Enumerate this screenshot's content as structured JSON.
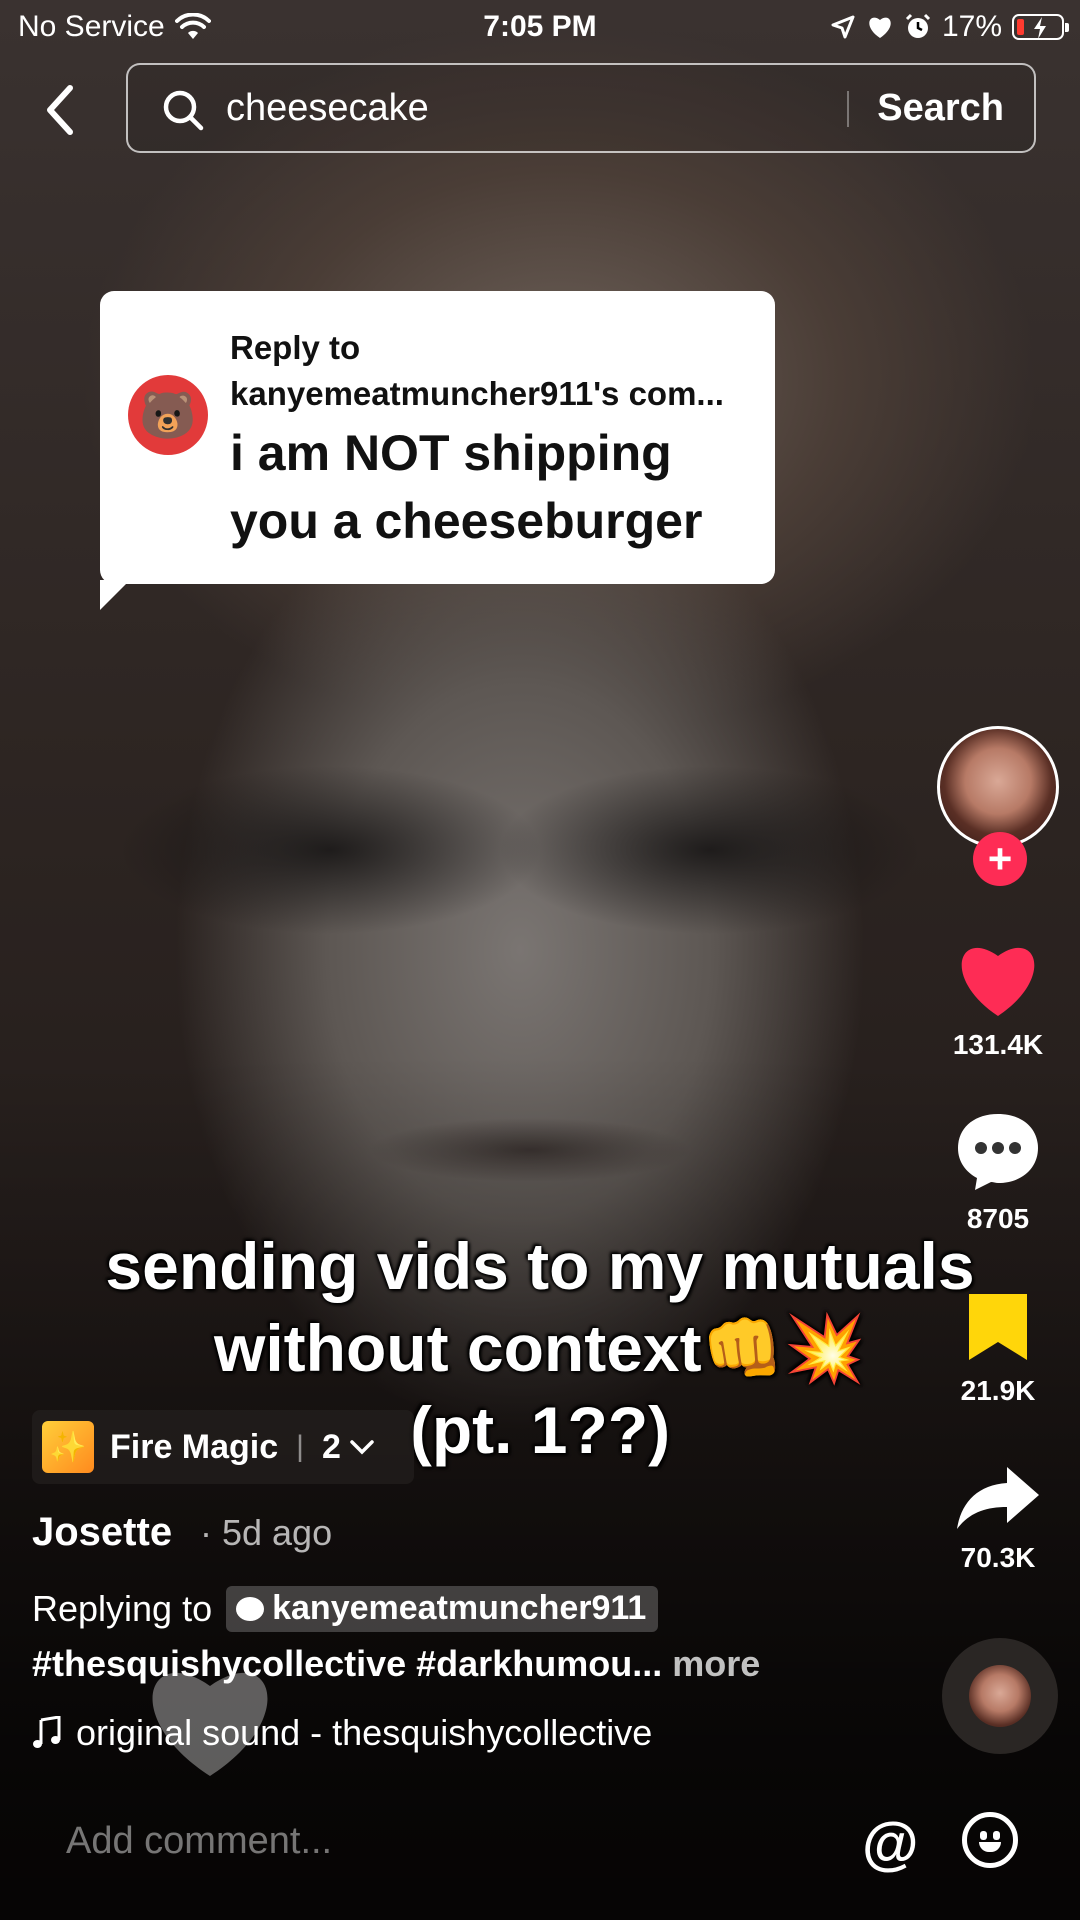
{
  "status_bar": {
    "carrier": "No Service",
    "time": "7:05 PM",
    "battery": "17%",
    "battery_level": 0.17
  },
  "search": {
    "query": "cheesecake",
    "button": "Search"
  },
  "reply_bubble": {
    "line1": "Reply to",
    "line2": "kanyemeatmuncher911's com...",
    "message": "i am NOT shipping you a cheeseburger"
  },
  "caption": {
    "line1": "sending vids to my mutuals",
    "line2": "without context👊💥",
    "line3": "(pt. 1??)"
  },
  "actions": {
    "likes": "131.4K",
    "comments": "8705",
    "saves": "21.9K",
    "shares": "70.3K"
  },
  "effect": {
    "name": "Fire Magic",
    "count": "2"
  },
  "post": {
    "author": "Josette",
    "time_ago": "· 5d ago",
    "replying_label": "Replying to",
    "replying_user": "kanyemeatmuncher911",
    "hashtags": "#thesquishycollective #darkhumou...",
    "more": "more",
    "sound": "original sound - thesquishycollective"
  },
  "comment_bar": {
    "placeholder": "Add comment..."
  },
  "colors": {
    "like": "#fe2c55",
    "save": "#ffd60a",
    "battery_low": "#ff3b30"
  }
}
